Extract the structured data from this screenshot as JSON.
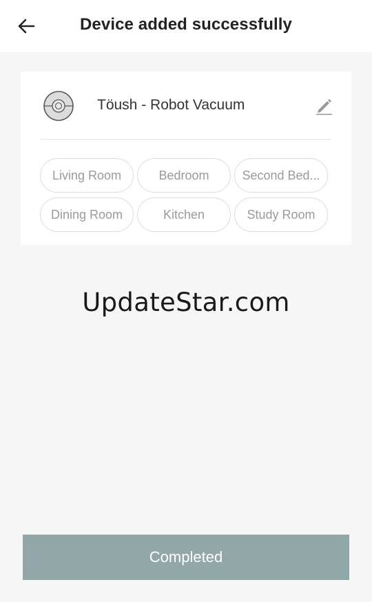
{
  "header": {
    "title": "Device added successfully",
    "back_icon": "arrow-left-icon"
  },
  "device": {
    "name": "Töush - Robot Vacuum",
    "icon": "robot-vacuum-icon",
    "edit_icon": "pencil-icon"
  },
  "rooms": [
    {
      "label": "Living Room"
    },
    {
      "label": "Bedroom"
    },
    {
      "label": "Second Bed..."
    },
    {
      "label": "Dining Room"
    },
    {
      "label": "Kitchen"
    },
    {
      "label": "Study Room"
    }
  ],
  "watermark": "UpdateStar.com",
  "footer": {
    "completed_label": "Completed"
  },
  "colors": {
    "button_bg": "#92a8a8",
    "background": "#f6f6f6"
  }
}
